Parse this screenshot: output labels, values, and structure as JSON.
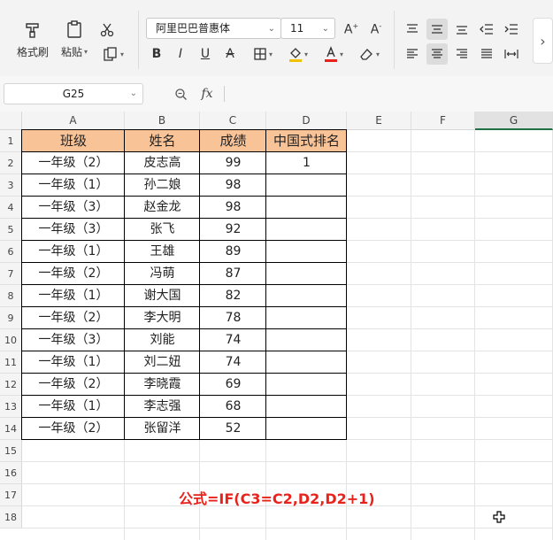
{
  "ribbon": {
    "format_painter": "格式刷",
    "paste": "粘贴",
    "font_name": "阿里巴巴普惠体",
    "font_size": "11"
  },
  "namebox": {
    "value": "G25"
  },
  "formula": {
    "fx_label": "fx",
    "content": ""
  },
  "columns": [
    "A",
    "B",
    "C",
    "D",
    "E",
    "F",
    "G"
  ],
  "rows": [
    "1",
    "2",
    "3",
    "4",
    "5",
    "6",
    "7",
    "8",
    "9",
    "10",
    "11",
    "12",
    "13",
    "14",
    "15",
    "16",
    "17",
    "18"
  ],
  "table": {
    "headers": [
      "班级",
      "姓名",
      "成绩",
      "中国式排名"
    ],
    "rows": [
      [
        "一年级（2）",
        "皮志高",
        "99",
        "1"
      ],
      [
        "一年级（1）",
        "孙二娘",
        "98",
        ""
      ],
      [
        "一年级（3）",
        "赵金龙",
        "98",
        ""
      ],
      [
        "一年级（3）",
        "张飞",
        "92",
        ""
      ],
      [
        "一年级（1）",
        "王雄",
        "89",
        ""
      ],
      [
        "一年级（2）",
        "冯萌",
        "87",
        ""
      ],
      [
        "一年级（1）",
        "谢大国",
        "82",
        ""
      ],
      [
        "一年级（2）",
        "李大明",
        "78",
        ""
      ],
      [
        "一年级（3）",
        "刘能",
        "74",
        ""
      ],
      [
        "一年级（1）",
        "刘二妞",
        "74",
        ""
      ],
      [
        "一年级（2）",
        "李晓霞",
        "69",
        ""
      ],
      [
        "一年级（1）",
        "李志强",
        "68",
        ""
      ],
      [
        "一年级（2）",
        "张留洋",
        "52",
        ""
      ]
    ]
  },
  "note": "公式=IF(C3=C2,D2,D2+1)",
  "colors": {
    "header_fill": "#f9c398",
    "note_color": "#e8231c",
    "active_col": "#1e7145"
  }
}
